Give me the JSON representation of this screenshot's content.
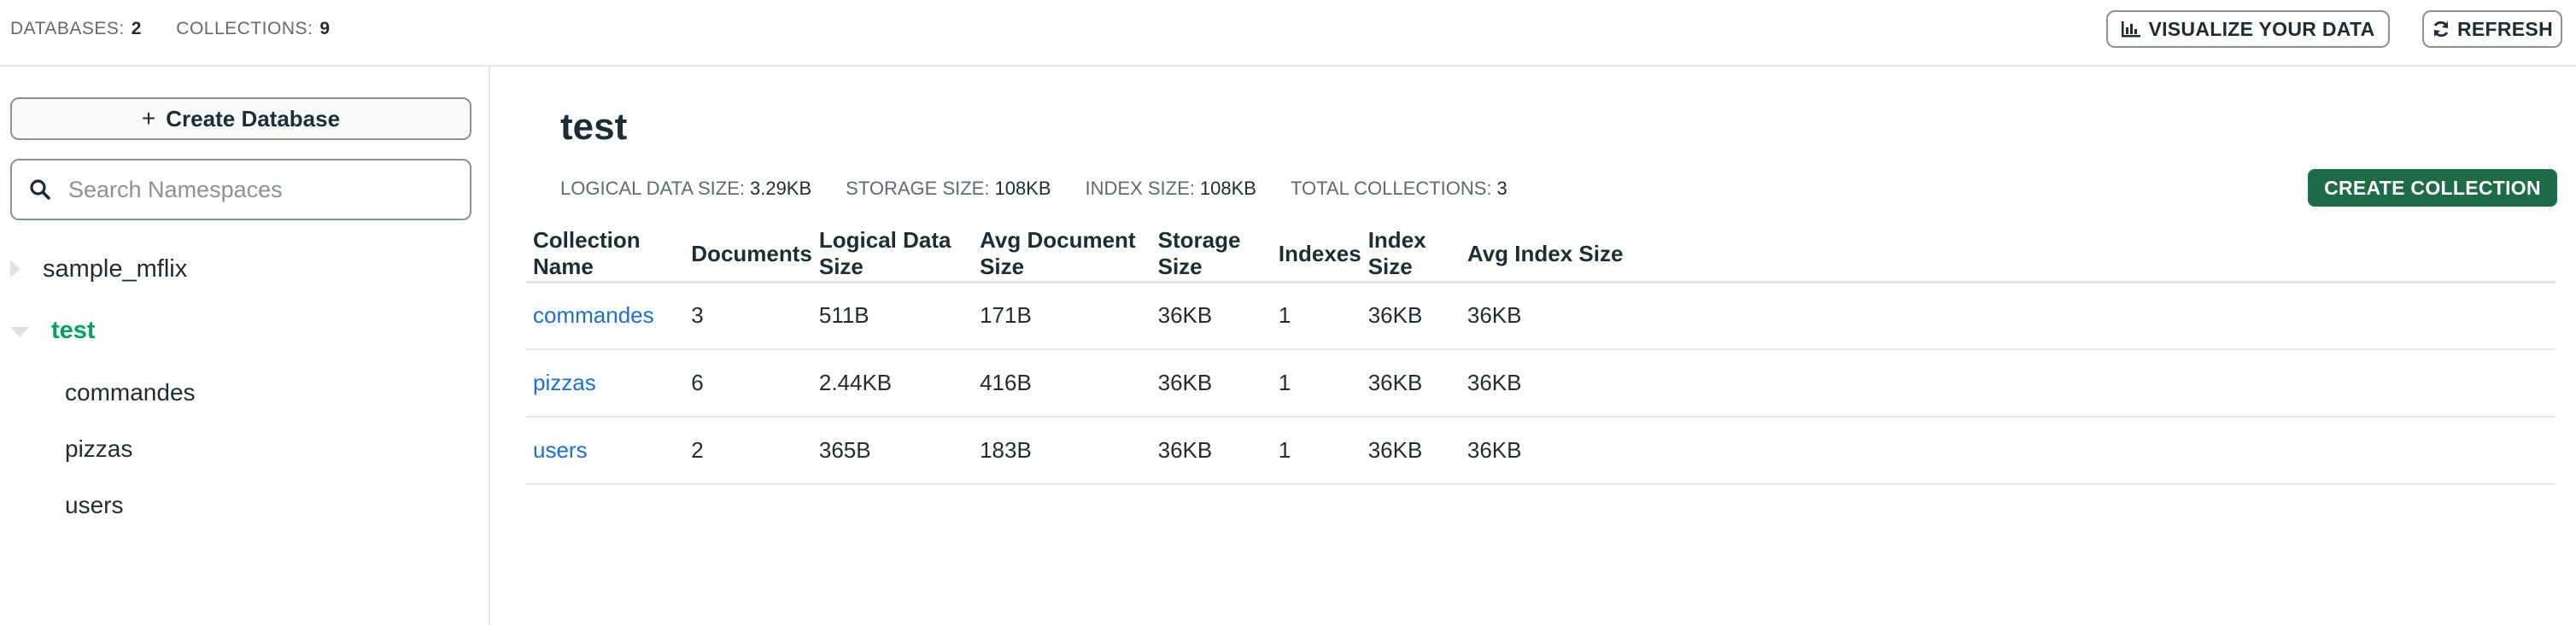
{
  "topbar": {
    "databases_label": "DATABASES:",
    "databases_count": "2",
    "collections_label": "COLLECTIONS:",
    "collections_count": "9",
    "visualize_label": "VISUALIZE YOUR DATA",
    "visualize_icon": "bar-chart-icon",
    "refresh_label": "REFRESH",
    "refresh_icon": "refresh-icon"
  },
  "sidebar": {
    "create_db_label": "Create Database",
    "search_placeholder": "Search Namespaces",
    "databases": [
      {
        "name": "sample_mflix",
        "expanded": false
      },
      {
        "name": "test",
        "expanded": true,
        "collections": [
          "commandes",
          "pizzas",
          "users"
        ]
      }
    ]
  },
  "main": {
    "db_name": "test",
    "stats": [
      {
        "label": "LOGICAL DATA SIZE:",
        "value": "3.29KB"
      },
      {
        "label": "STORAGE SIZE:",
        "value": "108KB"
      },
      {
        "label": "INDEX SIZE:",
        "value": "108KB"
      },
      {
        "label": "TOTAL COLLECTIONS:",
        "value": "3"
      }
    ],
    "create_collection_label": "CREATE COLLECTION",
    "table": {
      "headers": [
        "Collection Name",
        "Documents",
        "Logical Data Size",
        "Avg Document Size",
        "Storage Size",
        "Indexes",
        "Index Size",
        "Avg Index Size"
      ],
      "rows": [
        [
          "commandes",
          "3",
          "511B",
          "171B",
          "36KB",
          "1",
          "36KB",
          "36KB"
        ],
        [
          "pizzas",
          "6",
          "2.44KB",
          "416B",
          "36KB",
          "1",
          "36KB",
          "36KB"
        ],
        [
          "users",
          "2",
          "365B",
          "183B",
          "36KB",
          "1",
          "36KB",
          "36KB"
        ]
      ]
    }
  },
  "colors": {
    "accent_green": "#00a35c",
    "button_dark_green": "#1e6b47",
    "link_blue": "#1a6fd8",
    "text_dark": "#1c2d38",
    "border_gray": "#e3e6e8"
  }
}
